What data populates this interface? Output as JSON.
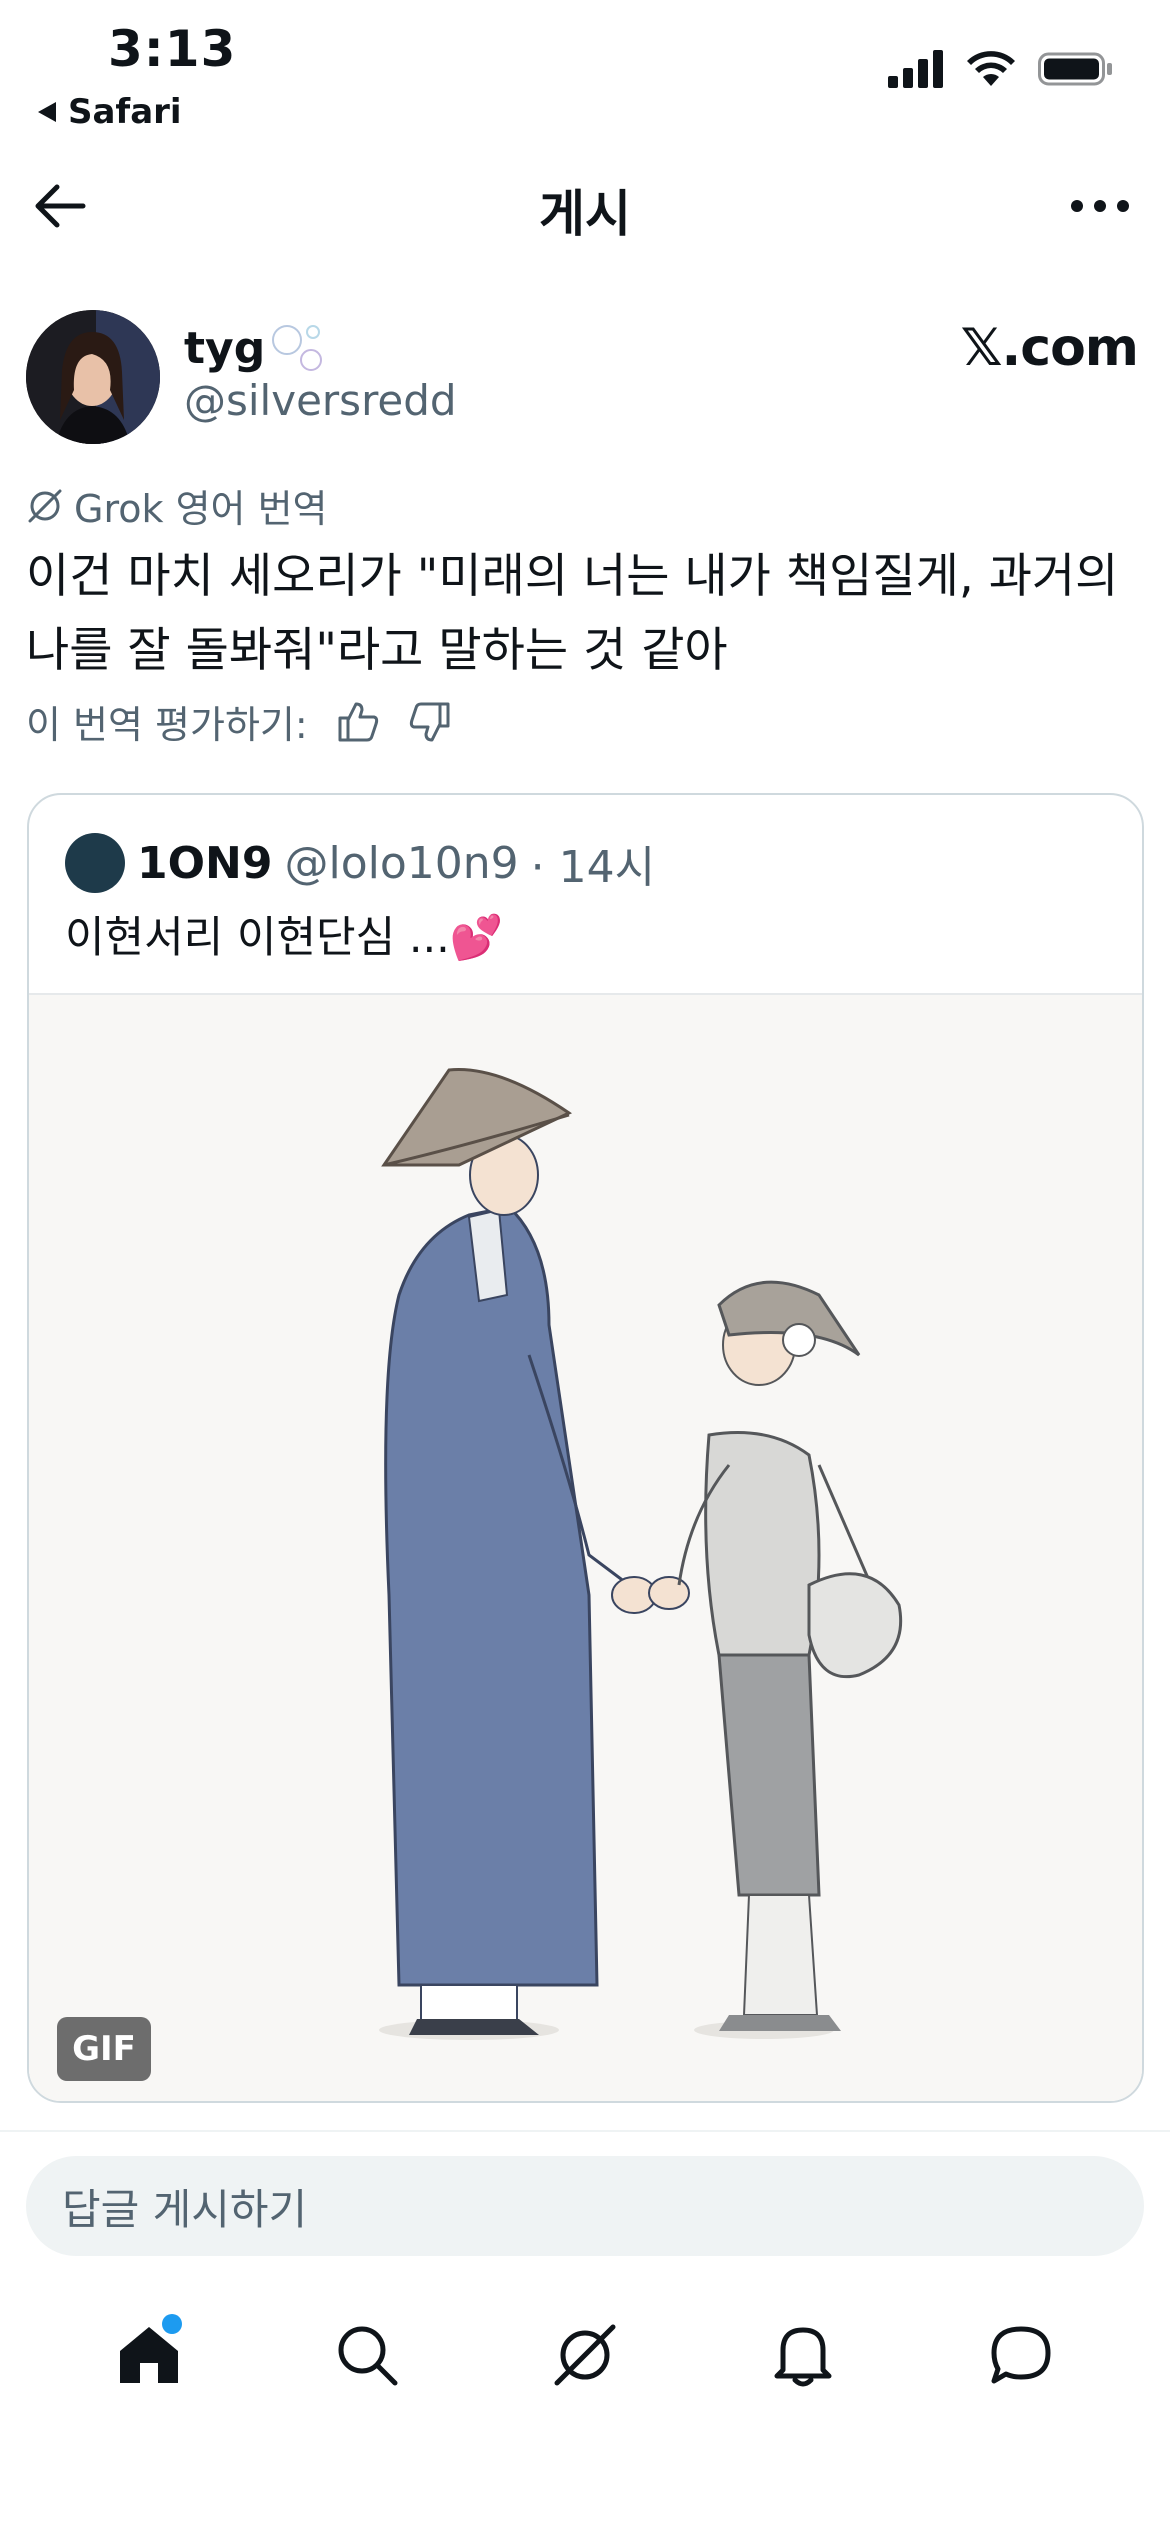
{
  "status_bar": {
    "time": "3:13",
    "back_app": "Safari"
  },
  "header": {
    "title": "게시"
  },
  "author": {
    "name": "tyg",
    "handle": "@silversredd",
    "brand": "𝕏.com"
  },
  "translation": {
    "label": "Grok 영어 번역",
    "text": "이건 마치 세오리가 \"미래의 너는 내가 책임질게, 과거의 나를 잘 돌봐줘\"라고 말하는 것 같아",
    "rate_label": "이 번역 평가하기:"
  },
  "quote": {
    "name": "1ON9",
    "handle": "@lolo10n9",
    "time": "· 14시",
    "text": "이현서리 이현단심 ...💕",
    "media_badge": "GIF"
  },
  "reply": {
    "placeholder": "답글 게시하기"
  },
  "icons": {
    "nav": [
      "home-icon",
      "search-icon",
      "grok-icon",
      "notifications-icon",
      "messages-icon"
    ]
  },
  "colors": {
    "accent": "#1d9bf0",
    "secondary_text": "#536471"
  }
}
